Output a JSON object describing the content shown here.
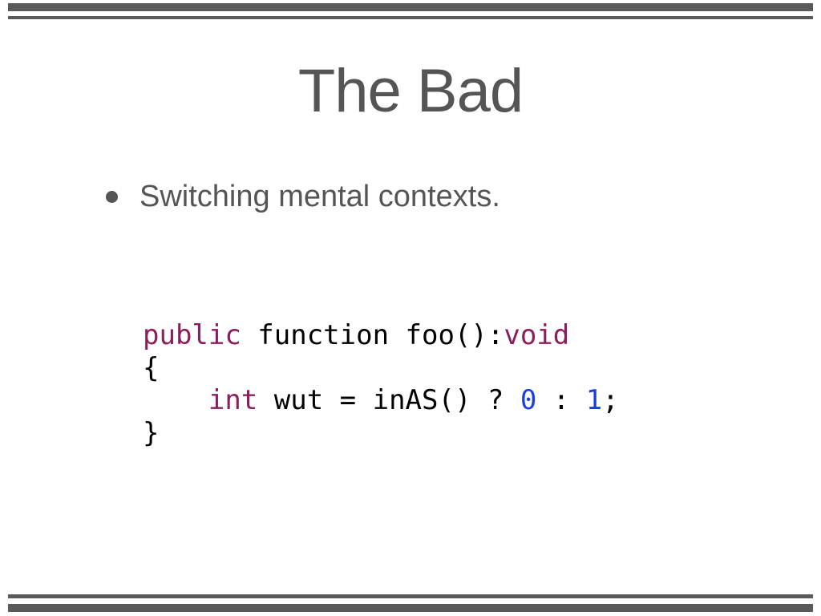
{
  "slide": {
    "title": "The Bad",
    "bullets": [
      "Switching mental contexts."
    ]
  },
  "code": {
    "line1": {
      "kw1": "public",
      "text1": " function foo():",
      "kw2": "void"
    },
    "line2": "{",
    "line3": {
      "indent": "    ",
      "kw": "int",
      "text1": " wut = inAS() ? ",
      "num1": "0",
      "text2": " : ",
      "num2": "1",
      "text3": ";"
    },
    "line4": "}"
  },
  "colors": {
    "rule": "#5a5a5a",
    "text": "#555555",
    "keyword": "#8a1f5b",
    "number": "#1a3fe0"
  }
}
